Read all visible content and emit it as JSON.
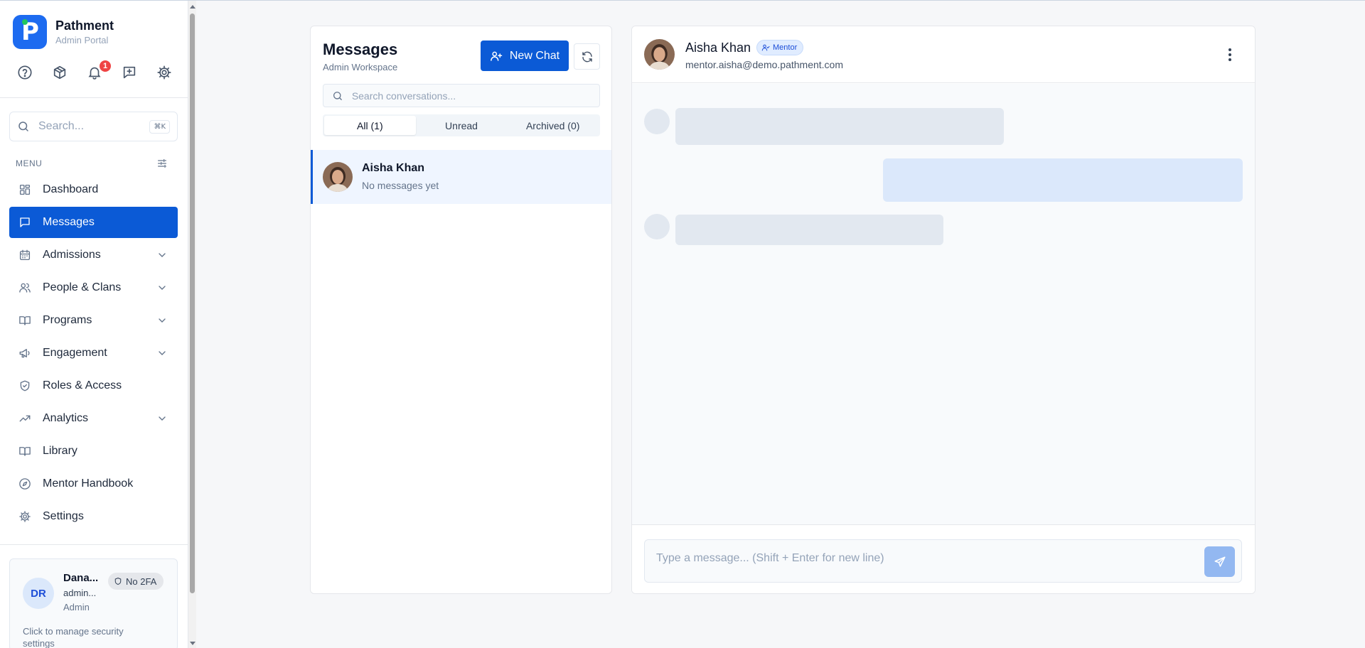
{
  "brand": {
    "name": "Pathment",
    "subtitle": "Admin Portal",
    "logo_letter": "P"
  },
  "quick_actions": {
    "icons": [
      "help-circle-icon",
      "package-icon",
      "bell-icon",
      "add-message-icon",
      "gear-icon"
    ],
    "notification_count": "1"
  },
  "sidebar_search": {
    "placeholder": "Search...",
    "shortcut": "⌘K"
  },
  "menu": {
    "label": "MENU",
    "items": [
      {
        "label": "Dashboard",
        "icon": "dashboard-icon",
        "expandable": false,
        "active": false
      },
      {
        "label": "Messages",
        "icon": "message-square-icon",
        "expandable": false,
        "active": true
      },
      {
        "label": "Admissions",
        "icon": "calendar-icon",
        "expandable": true,
        "active": false
      },
      {
        "label": "People & Clans",
        "icon": "users-icon",
        "expandable": true,
        "active": false
      },
      {
        "label": "Programs",
        "icon": "book-open-icon",
        "expandable": true,
        "active": false
      },
      {
        "label": "Engagement",
        "icon": "megaphone-icon",
        "expandable": true,
        "active": false
      },
      {
        "label": "Roles & Access",
        "icon": "shield-check-icon",
        "expandable": false,
        "active": false
      },
      {
        "label": "Analytics",
        "icon": "trending-up-icon",
        "expandable": true,
        "active": false
      },
      {
        "label": "Library",
        "icon": "library-icon",
        "expandable": false,
        "active": false
      },
      {
        "label": "Mentor Handbook",
        "icon": "compass-icon",
        "expandable": false,
        "active": false
      },
      {
        "label": "Settings",
        "icon": "gear-icon",
        "expandable": false,
        "active": false
      }
    ]
  },
  "user": {
    "initials": "DR",
    "name": "Dana...",
    "email": "admin...",
    "role": "Admin",
    "security_badge": "No 2FA",
    "hint": "Click to manage security settings"
  },
  "conversations": {
    "title": "Messages",
    "subtitle": "Admin Workspace",
    "new_chat_label": "New Chat",
    "search_placeholder": "Search conversations...",
    "tabs": [
      {
        "label": "All (1)",
        "active": true
      },
      {
        "label": "Unread",
        "active": false
      },
      {
        "label": "Archived (0)",
        "active": false
      }
    ],
    "items": [
      {
        "name": "Aisha Khan",
        "preview": "No messages yet",
        "selected": true
      }
    ]
  },
  "chat": {
    "contact_name": "Aisha Khan",
    "contact_role": "Mentor",
    "contact_email": "mentor.aisha@demo.pathment.com",
    "composer_placeholder": "Type a message... (Shift + Enter for new line)",
    "loading": true
  },
  "colors": {
    "primary": "#0b5ad6",
    "notification": "#ef4444",
    "skeleton": "#e2e8f0",
    "skeleton_mine": "#dbe8fb"
  }
}
